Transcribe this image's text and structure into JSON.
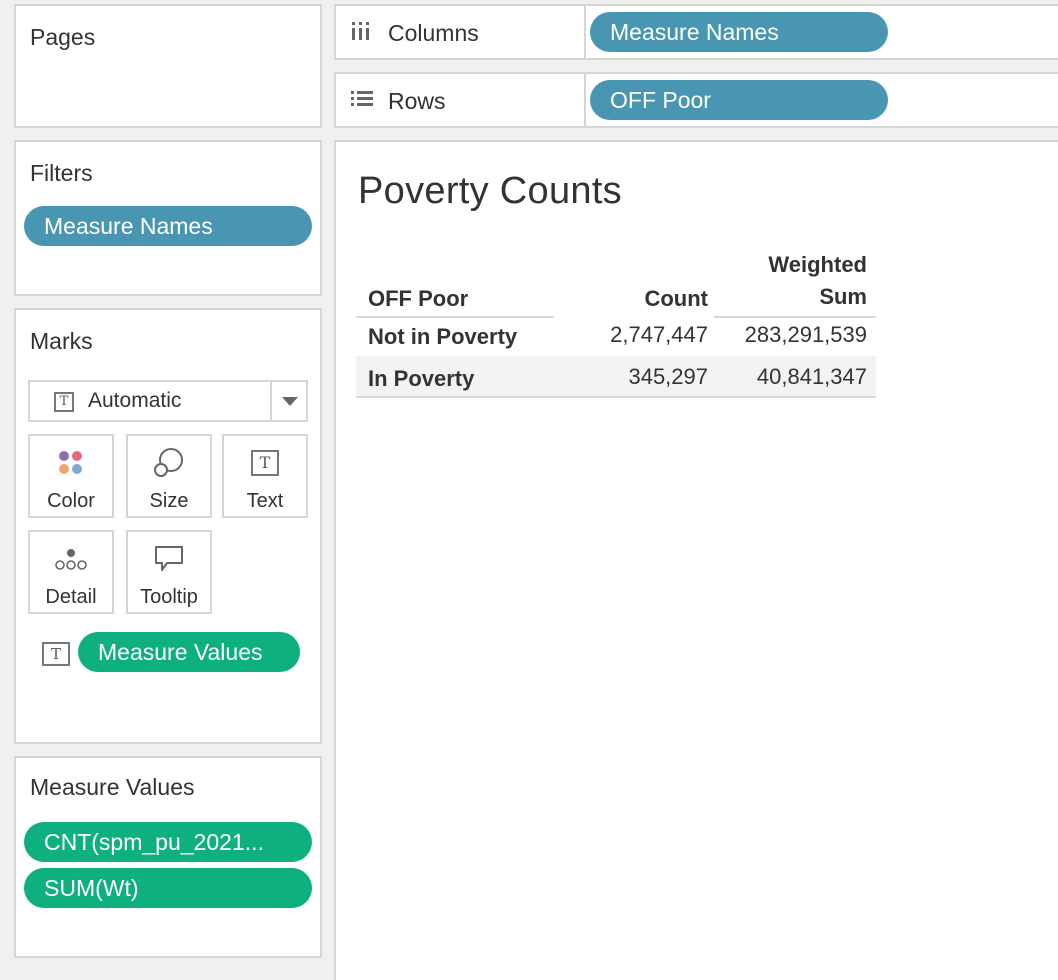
{
  "pages": {
    "title": "Pages"
  },
  "filters": {
    "title": "Filters",
    "pill": "Measure Names"
  },
  "marks": {
    "title": "Marks",
    "mark_type": "Automatic",
    "buttons": {
      "color": "Color",
      "size": "Size",
      "text": "Text",
      "detail": "Detail",
      "tooltip": "Tooltip"
    },
    "text_pill": "Measure Values"
  },
  "measure_values": {
    "title": "Measure Values",
    "pills": [
      "CNT(spm_pu_2021...",
      "SUM(Wt)"
    ]
  },
  "shelves": {
    "columns": {
      "label": "Columns",
      "pill": "Measure Names"
    },
    "rows": {
      "label": "Rows",
      "pill": "OFF Poor"
    }
  },
  "sheet": {
    "title": "Poverty Counts",
    "table": {
      "row_header": "OFF Poor",
      "col_headers": [
        "Count",
        "Weighted",
        "Sum"
      ],
      "rows": [
        {
          "label": "Not in Poverty",
          "count": "2,747,447",
          "weighted_sum": "283,291,539"
        },
        {
          "label": "In Poverty",
          "count": "345,297",
          "weighted_sum": "40,841,347"
        }
      ]
    }
  },
  "colors": {
    "blue_pill": "#4996b2",
    "green_pill": "#0fb07f",
    "panel_bg": "#f0f0f0",
    "border": "#d6d6d6"
  },
  "icons": {
    "columns": "columns-icon",
    "rows": "rows-icon",
    "color": "color-palette-icon",
    "size": "size-circles-icon",
    "text": "text-t-icon",
    "detail": "detail-dots-icon",
    "tooltip": "tooltip-speech-icon",
    "dropdown": "chevron-down-icon"
  }
}
